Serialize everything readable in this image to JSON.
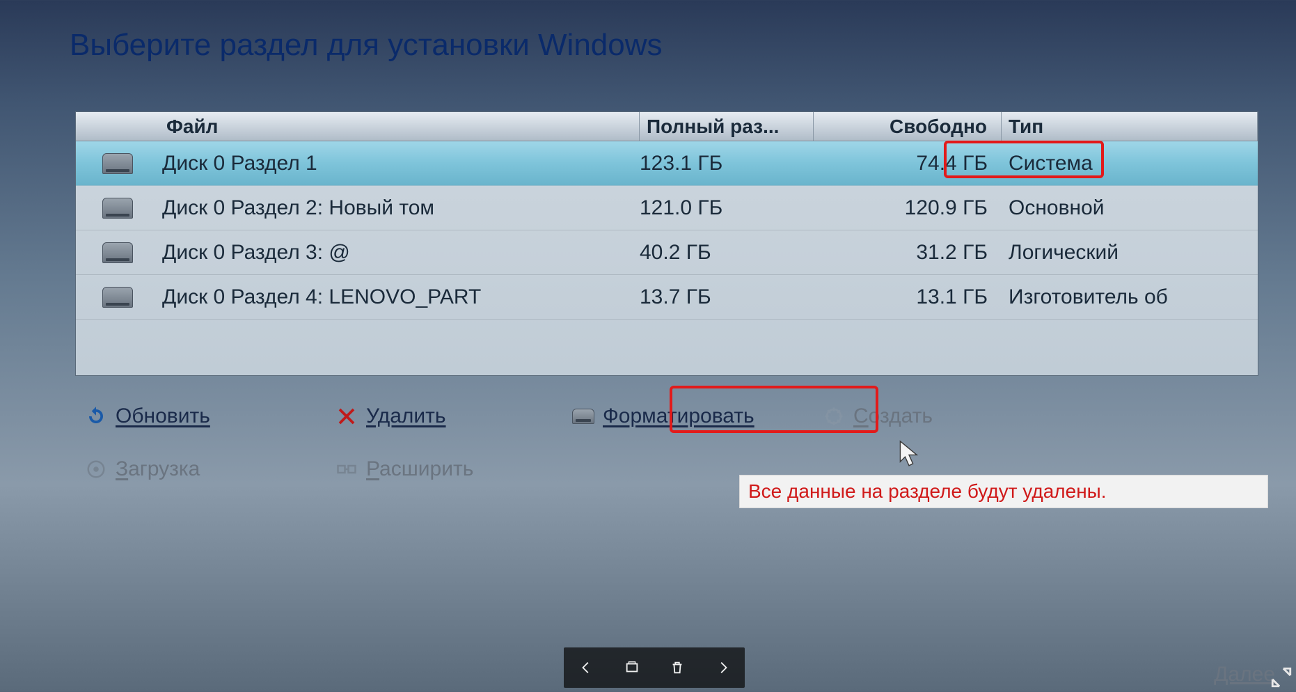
{
  "title": "Выберите раздел для установки Windows",
  "columns": {
    "name": "Файл",
    "size": "Полный раз...",
    "free": "Свободно",
    "type": "Тип"
  },
  "partitions": [
    {
      "name": "Диск 0 Раздел 1",
      "size": "123.1 ГБ",
      "free": "74.4 ГБ",
      "type": "Система",
      "selected": true
    },
    {
      "name": "Диск 0 Раздел 2: Новый том",
      "size": "121.0 ГБ",
      "free": "120.9 ГБ",
      "type": "Основной",
      "selected": false
    },
    {
      "name": "Диск 0 Раздел 3: @",
      "size": "40.2 ГБ",
      "free": "31.2 ГБ",
      "type": "Логический",
      "selected": false
    },
    {
      "name": "Диск 0 Раздел 4: LENOVO_PART",
      "size": "13.7 ГБ",
      "free": "13.1 ГБ",
      "type": "Изготовитель об",
      "selected": false
    }
  ],
  "actions": {
    "refresh": "Обновить",
    "delete": "Удалить",
    "format": "Форматировать",
    "create": "Создать",
    "load_driver": "Загрузка",
    "extend": "Расширить"
  },
  "callout": "Все данные на разделе будут удалены.",
  "next": "Далее"
}
